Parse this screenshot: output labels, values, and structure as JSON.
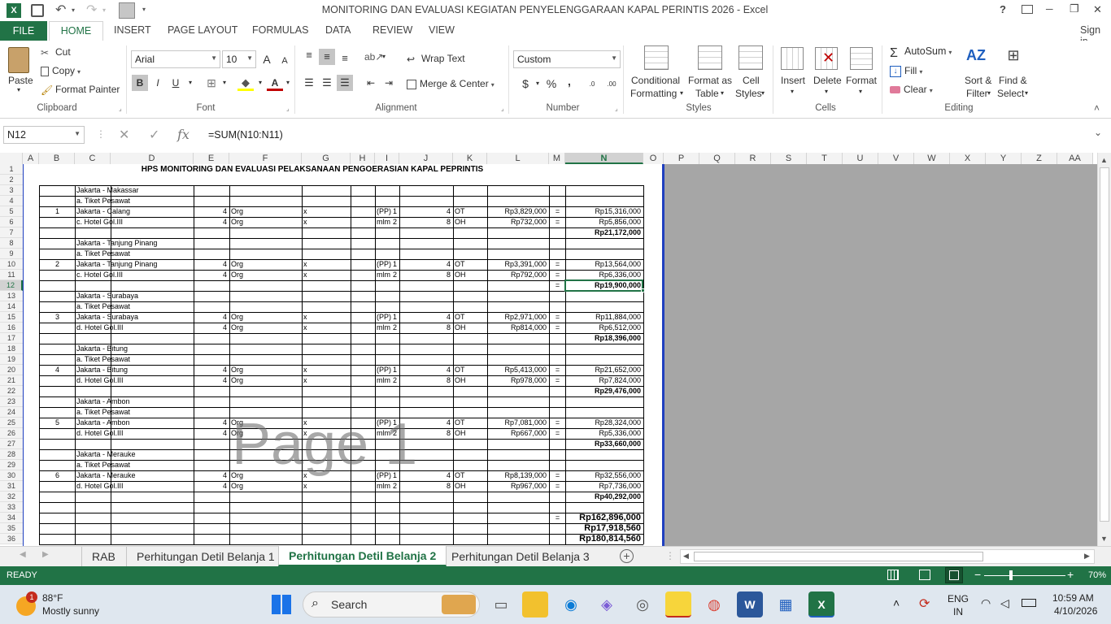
{
  "window": {
    "title": "MONITORING DAN EVALUASI KEGIATAN PENYELENGGARAAN KAPAL PERINTIS 2026 - Excel",
    "help": "?",
    "minimize": "─",
    "restore": "❐",
    "close": "✕"
  },
  "ribbon_tabs": [
    "FILE",
    "HOME",
    "INSERT",
    "PAGE LAYOUT",
    "FORMULAS",
    "DATA",
    "REVIEW",
    "VIEW"
  ],
  "signin": "Sign in",
  "clipboard": {
    "paste": "Paste",
    "cut": "Cut",
    "copy": "Copy",
    "format_painter": "Format Painter",
    "label": "Clipboard"
  },
  "font": {
    "name": "Arial",
    "size": "10",
    "bold": "B",
    "italic": "I",
    "underline": "U",
    "label": "Font",
    "grow": "A",
    "shrink": "A"
  },
  "alignment": {
    "wrap": "Wrap Text",
    "merge": "Merge & Center",
    "label": "Alignment"
  },
  "number": {
    "format": "Custom",
    "currency": "$",
    "percent": "%",
    "comma": ",",
    "inc": ".0",
    "dec": ".00",
    "label": "Number"
  },
  "styles": {
    "conditional": "Conditional",
    "conditional2": "Formatting",
    "format_table": "Format as",
    "format_table2": "Table",
    "cell_styles": "Cell",
    "cell_styles2": "Styles",
    "label": "Styles"
  },
  "cells": {
    "insert": "Insert",
    "delete": "Delete",
    "format": "Format",
    "label": "Cells"
  },
  "editing": {
    "autosum": "AutoSum",
    "fill": "Fill",
    "clear": "Clear",
    "sort": "Sort &",
    "sort2": "Filter",
    "find": "Find &",
    "find2": "Select",
    "label": "Editing"
  },
  "formula_bar": {
    "name_box": "N12",
    "formula": "=SUM(N10:N11)",
    "fx": "fx"
  },
  "columns": [
    "A",
    "B",
    "C",
    "D",
    "E",
    "F",
    "G",
    "H",
    "I",
    "J",
    "K",
    "L",
    "M",
    "N",
    "O",
    "P",
    "Q",
    "R",
    "S",
    "T",
    "U",
    "V",
    "W",
    "X",
    "Y",
    "Z",
    "AA"
  ],
  "sheet": {
    "title": "HPS MONITORING DAN EVALUASI PELAKSANAAN PENGOERASIAN KAPAL PEPRINTIS",
    "watermark": "Page 1",
    "groups": [
      {
        "no": "1",
        "route": "Jakarta - Makassar",
        "ticket": "a. Tiket Pesawat",
        "leg": "Jakarta - Calang",
        "leg_qty": "4",
        "unit": "Org",
        "x": "x",
        "pp": "1",
        "pp_u": "(PP)",
        "ot": "4",
        "ot_u": "OT",
        "price": "Rp3,829,000",
        "eq": "=",
        "total": "Rp15,316,000",
        "hotel": "c. Hotel Gol.III",
        "h_qty": "4",
        "h_unit": "Org",
        "h_x": "x",
        "h_n": "2",
        "h_nu": "mlm",
        "h_oh": "8",
        "h_ohu": "OH",
        "h_price": "Rp732,000",
        "h_eq": "=",
        "h_total": "Rp5,856,000",
        "sum": "Rp21,172,000"
      },
      {
        "no": "2",
        "route": "Jakarta - Tanjung Pinang",
        "ticket": "a. Tiket Pesawat",
        "leg": "Jakarta - Tanjung Pinang",
        "leg_qty": "4",
        "unit": "Org",
        "x": "x",
        "pp": "1",
        "pp_u": "(PP)",
        "ot": "4",
        "ot_u": "OT",
        "price": "Rp3,391,000",
        "eq": "=",
        "total": "Rp13,564,000",
        "hotel": "c. Hotel Gol.III",
        "h_qty": "4",
        "h_unit": "Org",
        "h_x": "x",
        "h_n": "2",
        "h_nu": "mlm",
        "h_oh": "8",
        "h_ohu": "OH",
        "h_price": "Rp792,000",
        "h_eq": "=",
        "h_total": "Rp6,336,000",
        "sum": "Rp19,900,000",
        "sum_eq": "="
      },
      {
        "no": "3",
        "route": "Jakarta - Surabaya",
        "ticket": "a. Tiket Pesawat",
        "leg": "Jakarta - Surabaya",
        "leg_qty": "4",
        "unit": "Org",
        "x": "x",
        "pp": "1",
        "pp_u": "(PP)",
        "ot": "4",
        "ot_u": "OT",
        "price": "Rp2,971,000",
        "eq": "=",
        "total": "Rp11,884,000",
        "hotel": "d. Hotel Gol.III",
        "h_qty": "4",
        "h_unit": "Org",
        "h_x": "x",
        "h_n": "2",
        "h_nu": "mlm",
        "h_oh": "8",
        "h_ohu": "OH",
        "h_price": "Rp814,000",
        "h_eq": "=",
        "h_total": "Rp6,512,000",
        "sum": "Rp18,396,000"
      },
      {
        "no": "4",
        "route": "Jakarta - Bitung",
        "ticket": "a. Tiket Pesawat",
        "leg": "Jakarta - Bitung",
        "leg_qty": "4",
        "unit": "Org",
        "x": "x",
        "pp": "1",
        "pp_u": "(PP)",
        "ot": "4",
        "ot_u": "OT",
        "price": "Rp5,413,000",
        "eq": "=",
        "total": "Rp21,652,000",
        "hotel": "d. Hotel Gol.III",
        "h_qty": "4",
        "h_unit": "Org",
        "h_x": "x",
        "h_n": "2",
        "h_nu": "mlm",
        "h_oh": "8",
        "h_ohu": "OH",
        "h_price": "Rp978,000",
        "h_eq": "=",
        "h_total": "Rp7,824,000",
        "sum": "Rp29,476,000"
      },
      {
        "no": "5",
        "route": "Jakarta - Ambon",
        "ticket": "a. Tiket Pesawat",
        "leg": "Jakarta - Ambon",
        "leg_qty": "4",
        "unit": "Org",
        "x": "x",
        "pp": "1",
        "pp_u": "(PP)",
        "ot": "4",
        "ot_u": "OT",
        "price": "Rp7,081,000",
        "eq": "=",
        "total": "Rp28,324,000",
        "hotel": "d. Hotel Gol.III",
        "h_qty": "4",
        "h_unit": "Org",
        "h_x": "x",
        "h_n": "2",
        "h_nu": "mlm",
        "h_oh": "8",
        "h_ohu": "OH",
        "h_price": "Rp667,000",
        "h_eq": "=",
        "h_total": "Rp5,336,000",
        "sum": "Rp33,660,000"
      },
      {
        "no": "6",
        "route": "Jakarta - Merauke",
        "ticket": "a. Tiket Pesawat",
        "leg": "Jakarta - Merauke",
        "leg_qty": "4",
        "unit": "Org",
        "x": "x",
        "pp": "1",
        "pp_u": "(PP)",
        "ot": "4",
        "ot_u": "OT",
        "price": "Rp8,139,000",
        "eq": "=",
        "total": "Rp32,556,000",
        "hotel": "d. Hotel Gol.III",
        "h_qty": "4",
        "h_unit": "Org",
        "h_x": "x",
        "h_n": "2",
        "h_nu": "mlm",
        "h_oh": "8",
        "h_ohu": "OH",
        "h_price": "Rp967,000",
        "h_eq": "=",
        "h_total": "Rp7,736,000",
        "sum": "Rp40,292,000"
      }
    ],
    "grand_eq": "=",
    "grand_total": "Rp162,896,000",
    "tax": "Rp17,918,560",
    "final": "Rp180,814,560"
  },
  "sheet_tabs": [
    "RAB",
    "Perhitungan Detil Belanja 1",
    "Perhitungan Detil Belanja 2",
    "Perhitungan Detil Belanja 3"
  ],
  "active_sheet": "Perhitungan Detil Belanja 2",
  "status": {
    "ready": "READY",
    "zoom": "70%"
  },
  "taskbar": {
    "temp": "88°F",
    "weather": "Mostly sunny",
    "badge": "1",
    "search": "Search",
    "lang1": "ENG",
    "lang2": "IN",
    "time": "10:59 AM",
    "date": "4/10/2026"
  },
  "colors": {
    "excel_green": "#217346",
    "grid_gray": "#a6a6a6",
    "selection": "#217346"
  }
}
